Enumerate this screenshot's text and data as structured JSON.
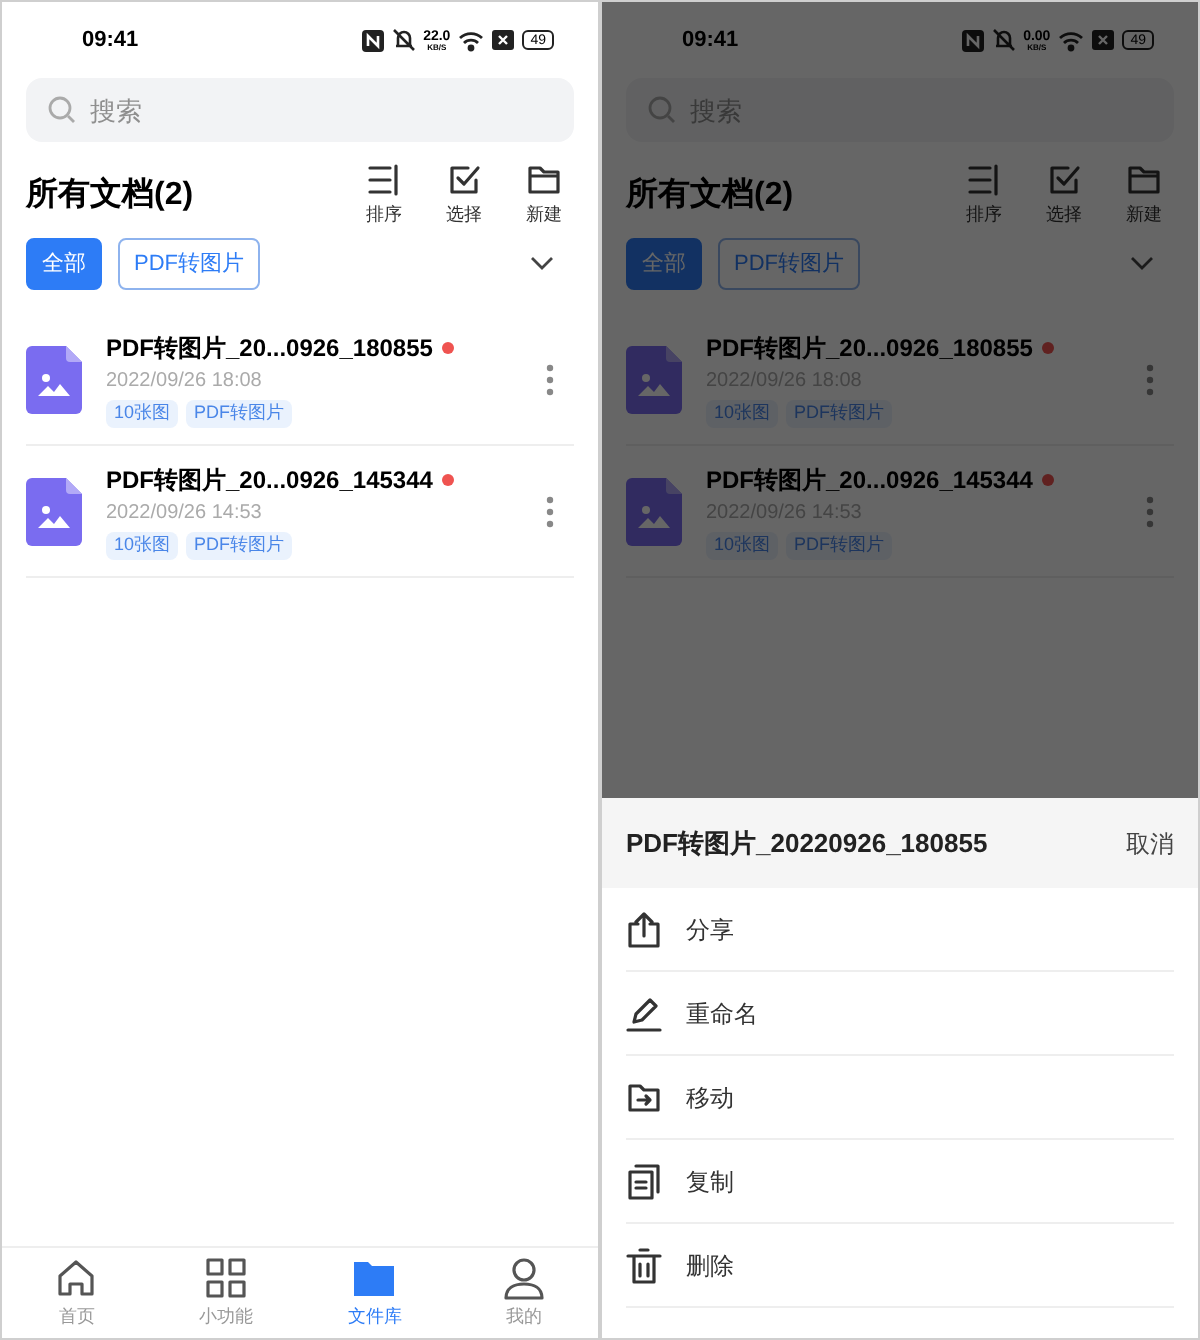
{
  "screens": [
    {
      "status_bar": {
        "time": "09:41",
        "speed": "22.0",
        "speed_unit": "KB/S",
        "battery": "49"
      },
      "search": {
        "placeholder": "搜索"
      },
      "title": "所有文档(2)",
      "actions": [
        {
          "kind": "sort",
          "label": "排序"
        },
        {
          "kind": "select",
          "label": "选择"
        },
        {
          "kind": "new",
          "label": "新建"
        }
      ],
      "filters": [
        {
          "label": "全部",
          "selected": true
        },
        {
          "label": "PDF转图片",
          "selected": false
        }
      ],
      "files": [
        {
          "name": "PDF转图片_20...0926_180855",
          "date": "2022/09/26 18:08",
          "tags": [
            "10张图",
            "PDF转图片"
          ],
          "unread": true
        },
        {
          "name": "PDF转图片_20...0926_145344",
          "date": "2022/09/26 14:53",
          "tags": [
            "10张图",
            "PDF转图片"
          ],
          "unread": true
        }
      ],
      "dimmed": false,
      "bottom_nav": [
        {
          "kind": "home",
          "label": "首页",
          "selected": false
        },
        {
          "kind": "grid",
          "label": "小功能",
          "selected": false
        },
        {
          "kind": "folder",
          "label": "文件库",
          "selected": true
        },
        {
          "kind": "user",
          "label": "我的",
          "selected": false
        }
      ]
    },
    {
      "status_bar": {
        "time": "09:41",
        "speed": "0.00",
        "speed_unit": "KB/S",
        "battery": "49"
      },
      "search": {
        "placeholder": "搜索"
      },
      "title": "所有文档(2)",
      "actions": [
        {
          "kind": "sort",
          "label": "排序"
        },
        {
          "kind": "select",
          "label": "选择"
        },
        {
          "kind": "new",
          "label": "新建"
        }
      ],
      "filters": [
        {
          "label": "全部",
          "selected": true
        },
        {
          "label": "PDF转图片",
          "selected": false
        }
      ],
      "files": [
        {
          "name": "PDF转图片_20...0926_180855",
          "date": "2022/09/26 18:08",
          "tags": [
            "10张图",
            "PDF转图片"
          ],
          "unread": true
        },
        {
          "name": "PDF转图片_20...0926_145344",
          "date": "2022/09/26 14:53",
          "tags": [
            "10张图",
            "PDF转图片"
          ],
          "unread": true
        }
      ],
      "dimmed": true,
      "action_sheet": {
        "title": "PDF转图片_20220926_180855",
        "cancel": "取消",
        "items": [
          {
            "kind": "share",
            "label": "分享"
          },
          {
            "kind": "rename",
            "label": "重命名"
          },
          {
            "kind": "move",
            "label": "移动"
          },
          {
            "kind": "copy",
            "label": "复制"
          },
          {
            "kind": "delete",
            "label": "删除"
          }
        ]
      }
    }
  ]
}
